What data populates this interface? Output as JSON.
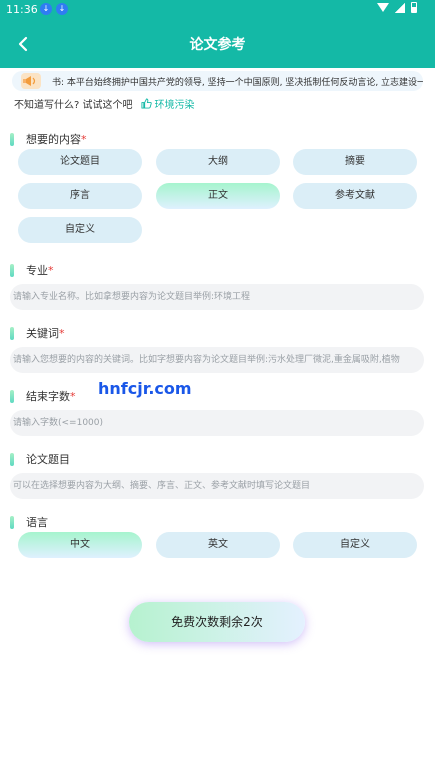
{
  "status_bar": {
    "time": "11:36"
  },
  "header": {
    "title": "论文参考"
  },
  "notice": {
    "text": "书: 本平台始终拥护中国共产党的领导, 坚持一个中国原则, 坚决抵制任何反动言论, 立志建设一"
  },
  "hint": {
    "question": "不知道写什么? 试试这个吧",
    "suggestion": "环境污染"
  },
  "content_type": {
    "label": "想要的内容",
    "required_mark": "*",
    "options": [
      "论文题目",
      "大纲",
      "摘要",
      "序言",
      "正文",
      "参考文献",
      "自定义"
    ],
    "selected": "正文"
  },
  "major": {
    "label": "专业",
    "required_mark": "*",
    "placeholder": "请输入专业名称。比如拿想要内容为论文题目举例:环境工程"
  },
  "keywords": {
    "label": "关键词",
    "required_mark": "*",
    "placeholder": "请输入您想要的内容的关键词。比如字想要内容为论文题目举例:污水处理厂微泥,重金属吸附,植物"
  },
  "word_count": {
    "label": "结束字数",
    "required_mark": "*",
    "placeholder": "请输入字数(<=1000)"
  },
  "paper_title": {
    "label": "论文题目",
    "placeholder": "可以在选择想要内容为大纲、摘要、序言、正文、参考文献时填写论文题目"
  },
  "language": {
    "label": "语言",
    "options": [
      "中文",
      "英文",
      "自定义"
    ],
    "selected": "中文"
  },
  "watermark": "hnfcjr.com",
  "submit": {
    "label": "免费次数剩余2次"
  },
  "colors": {
    "header_bg": "#14b9a6",
    "chip_bg": "#dbeef7",
    "required": "#e53935",
    "link": "#14b9a6"
  }
}
